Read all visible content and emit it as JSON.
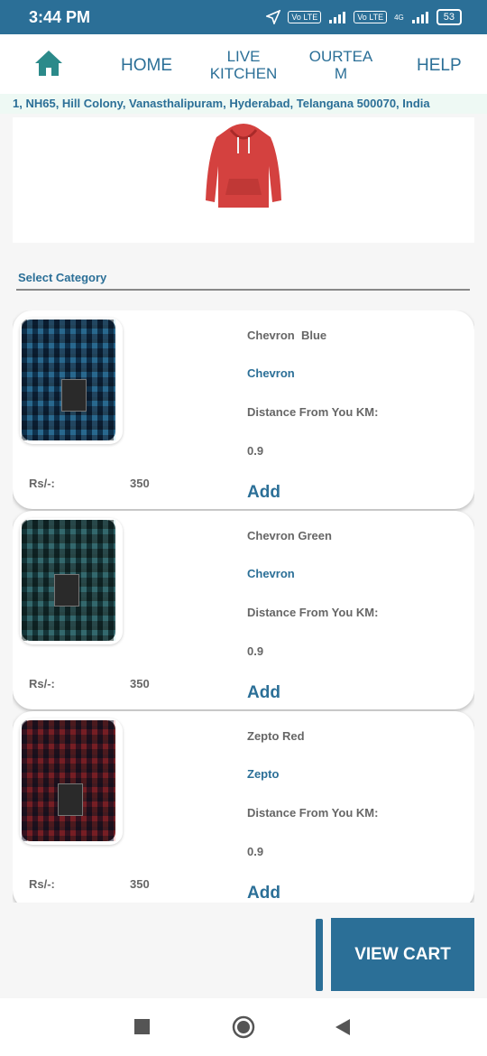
{
  "status_bar": {
    "time": "3:44 PM",
    "lte1": "Vo LTE",
    "lte2": "Vo LTE",
    "net": "4G",
    "battery": "53"
  },
  "nav": {
    "home_icon": "home-icon",
    "home": "HOME",
    "live_kitchen_1": "LIVE",
    "live_kitchen_2": "KITCHEN",
    "ourteam_1": "OURTEA",
    "ourteam_2": "M",
    "help": "HELP"
  },
  "address": "1, NH65, Hill Colony, Vanasthalipuram, Hyderabad, Telangana 500070, India",
  "select_category": "Select Category",
  "products": [
    {
      "name": "Chevron  Blue",
      "brand": "Chevron",
      "distance_label": "Distance From You KM:",
      "distance": "0.9",
      "currency": "Rs/-:",
      "price": "350",
      "add": "Add",
      "color": "#2f6f8f"
    },
    {
      "name": "Chevron Green",
      "brand": "Chevron",
      "distance_label": "Distance From You KM:",
      "distance": "0.9",
      "currency": "Rs/-:",
      "price": "350",
      "add": "Add",
      "color": "#3b6d73"
    },
    {
      "name": "Zepto Red",
      "brand": "Zepto",
      "distance_label": "Distance From You KM:",
      "distance": "0.9",
      "currency": "Rs/-:",
      "price": "350",
      "add": "Add",
      "color": "#7a2a34"
    }
  ],
  "view_cart": "VIEW  CART",
  "colors": {
    "primary": "#2b6f97",
    "address_bg": "#eef9f4"
  }
}
